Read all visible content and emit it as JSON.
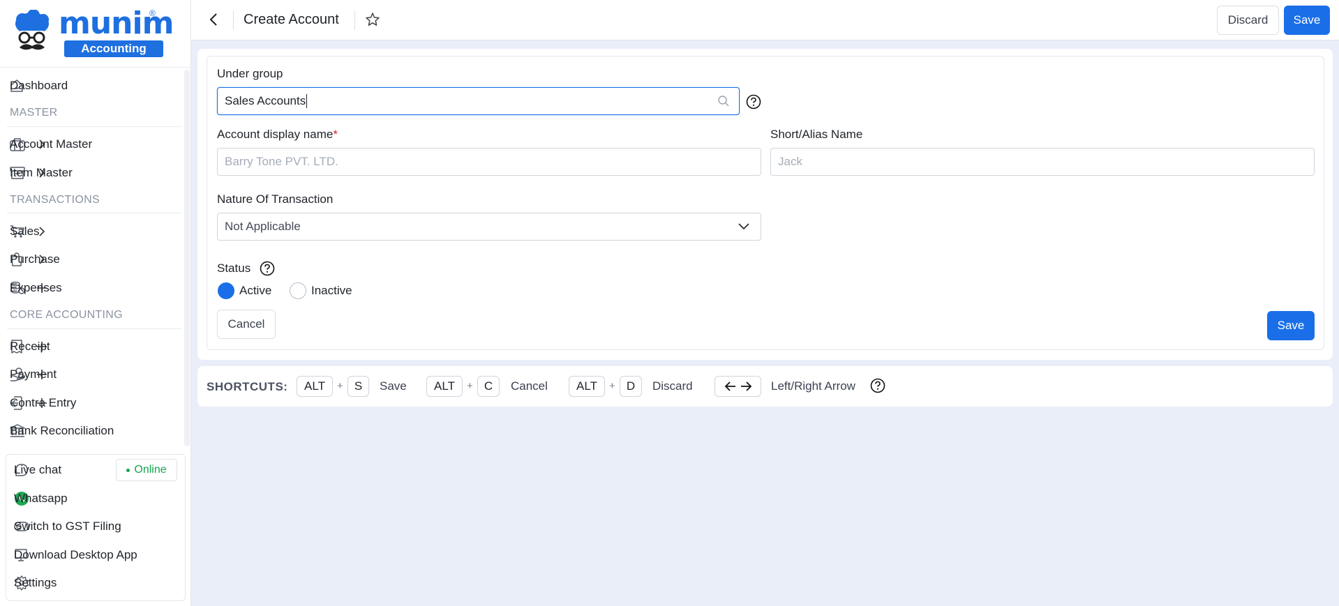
{
  "brand": {
    "name": "munim",
    "registered": "®",
    "badge": "Accounting"
  },
  "sidebar": {
    "items": [
      {
        "label": "Dashboard",
        "icon": "home-icon"
      },
      {
        "label": "Account Master",
        "icon": "briefcase-icon",
        "action": "chevron-right-icon"
      },
      {
        "label": "Item Master",
        "icon": "archive-box-icon",
        "action": "chevron-right-icon"
      },
      {
        "label": "Sales",
        "icon": "cart-icon",
        "action": "chevron-right-icon"
      },
      {
        "label": "Purchase",
        "icon": "shopping-bag-icon",
        "action": "chevron-right-icon"
      },
      {
        "label": "Expenses",
        "icon": "coins-icon",
        "action": "plus-icon"
      },
      {
        "label": "Receipt",
        "icon": "receipt-icon",
        "action": "plus-icon"
      },
      {
        "label": "Payment",
        "icon": "hand-coin-icon",
        "action": "plus-icon"
      },
      {
        "label": "Contra Entry",
        "icon": "contra-entry-icon",
        "action": "plus-icon"
      },
      {
        "label": "Bank Reconciliation",
        "icon": "bank-icon"
      }
    ],
    "sections": [
      "MASTER",
      "TRANSACTIONS",
      "CORE ACCOUNTING"
    ],
    "bottom": [
      {
        "label": "Live chat",
        "icon": "chat-icon"
      },
      {
        "label": "Whatsapp",
        "icon": "whatsapp-icon"
      },
      {
        "label": "Switch to GST Filing",
        "icon": "toggle-icon"
      },
      {
        "label": "Download Desktop App",
        "icon": "monitor-icon"
      },
      {
        "label": "Settings",
        "icon": "gear-icon"
      }
    ],
    "online_label": "Online"
  },
  "header": {
    "title": "Create Account",
    "discard_label": "Discard",
    "save_label": "Save"
  },
  "form": {
    "under_group": {
      "label": "Under group",
      "value": "Sales Accounts"
    },
    "display_name": {
      "label": "Account display name",
      "required_mark": "*",
      "placeholder": "Barry Tone PVT. LTD."
    },
    "alias": {
      "label": "Short/Alias Name",
      "placeholder": "Jack"
    },
    "nature": {
      "label": "Nature Of Transaction",
      "value": "Not Applicable"
    },
    "status": {
      "label": "Status",
      "options": [
        "Active",
        "Inactive"
      ],
      "selected": "Active"
    },
    "cancel_label": "Cancel",
    "save_label": "Save"
  },
  "shortcuts": {
    "title": "SHORTCUTS:",
    "plus": "+",
    "items": [
      {
        "modifier": "ALT",
        "key": "S",
        "label": "Save"
      },
      {
        "modifier": "ALT",
        "key": "C",
        "label": "Cancel"
      },
      {
        "modifier": "ALT",
        "key": "D",
        "label": "Discard"
      }
    ],
    "arrows_label": "Left/Right Arrow"
  },
  "colors": {
    "accent": "#1a6fe8",
    "online": "#14a44d",
    "required": "#e11d2e",
    "background": "#e9eef9"
  }
}
